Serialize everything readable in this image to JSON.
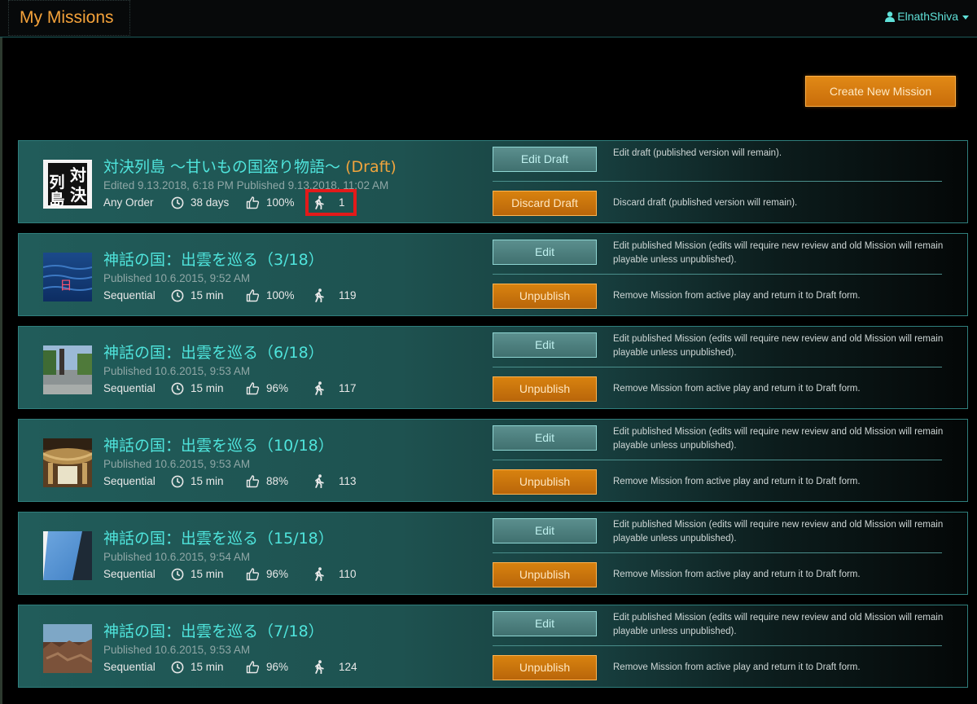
{
  "header": {
    "title": "My Missions",
    "user": "ElnathShiva"
  },
  "create_button": "Create New Mission",
  "missions": [
    {
      "title": "対決列島 ～甘いもの国盗り物語～",
      "draft_label": "(Draft)",
      "meta1": "Edited 9.13.2018, 6:18 PM   Published 9.13.2018, 11:02 AM",
      "order": "Any Order",
      "time": "38 days",
      "rating": "100%",
      "players": "1",
      "btn_primary": "Edit Draft",
      "btn_primary_desc": "Edit draft (published version will remain).",
      "btn_secondary": "Discard Draft",
      "btn_secondary_desc": "Discard draft (published version will remain).",
      "thumb": "kanji",
      "thumb_text": [
        "対",
        "決",
        "列",
        "島"
      ]
    },
    {
      "title": "神話の国：出雲を巡る（3/18）",
      "draft_label": "",
      "meta1": "Published 10.6.2015, 9:52 AM",
      "order": "Sequential",
      "time": "15 min",
      "rating": "100%",
      "players": "119",
      "btn_primary": "Edit",
      "btn_primary_desc": "Edit published Mission (edits will require new review and old Mission will remain playable unless unpublished).",
      "btn_secondary": "Unpublish",
      "btn_secondary_desc": "Remove Mission from active play and return it to Draft form.",
      "thumb": "sea",
      "thumb_text": [
        "日"
      ]
    },
    {
      "title": "神話の国：出雲を巡る（6/18）",
      "draft_label": "",
      "meta1": "Published 10.6.2015, 9:53 AM",
      "order": "Sequential",
      "time": "15 min",
      "rating": "96%",
      "players": "117",
      "btn_primary": "Edit",
      "btn_primary_desc": "Edit published Mission (edits will require new review and old Mission will remain playable unless unpublished).",
      "btn_secondary": "Unpublish",
      "btn_secondary_desc": "Remove Mission from active play and return it to Draft form.",
      "thumb": "road",
      "thumb_text": []
    },
    {
      "title": "神話の国：出雲を巡る（10/18）",
      "draft_label": "",
      "meta1": "Published 10.6.2015, 9:53 AM",
      "order": "Sequential",
      "time": "15 min",
      "rating": "88%",
      "players": "113",
      "btn_primary": "Edit",
      "btn_primary_desc": "Edit published Mission (edits will require new review and old Mission will remain playable unless unpublished).",
      "btn_secondary": "Unpublish",
      "btn_secondary_desc": "Remove Mission from active play and return it to Draft form.",
      "thumb": "rope",
      "thumb_text": []
    },
    {
      "title": "神話の国：出雲を巡る（15/18）",
      "draft_label": "",
      "meta1": "Published 10.6.2015, 9:54 AM",
      "order": "Sequential",
      "time": "15 min",
      "rating": "96%",
      "players": "110",
      "btn_primary": "Edit",
      "btn_primary_desc": "Edit published Mission (edits will require new review and old Mission will remain playable unless unpublished).",
      "btn_secondary": "Unpublish",
      "btn_secondary_desc": "Remove Mission from active play and return it to Draft form.",
      "thumb": "sky",
      "thumb_text": []
    },
    {
      "title": "神話の国：出雲を巡る（7/18）",
      "draft_label": "",
      "meta1": "Published 10.6.2015, 9:53 AM",
      "order": "Sequential",
      "time": "15 min",
      "rating": "96%",
      "players": "124",
      "btn_primary": "Edit",
      "btn_primary_desc": "Edit published Mission (edits will require new review and old Mission will remain playable unless unpublished).",
      "btn_secondary": "Unpublish",
      "btn_secondary_desc": "Remove Mission from active play and return it to Draft form.",
      "thumb": "rocks",
      "thumb_text": []
    }
  ]
}
